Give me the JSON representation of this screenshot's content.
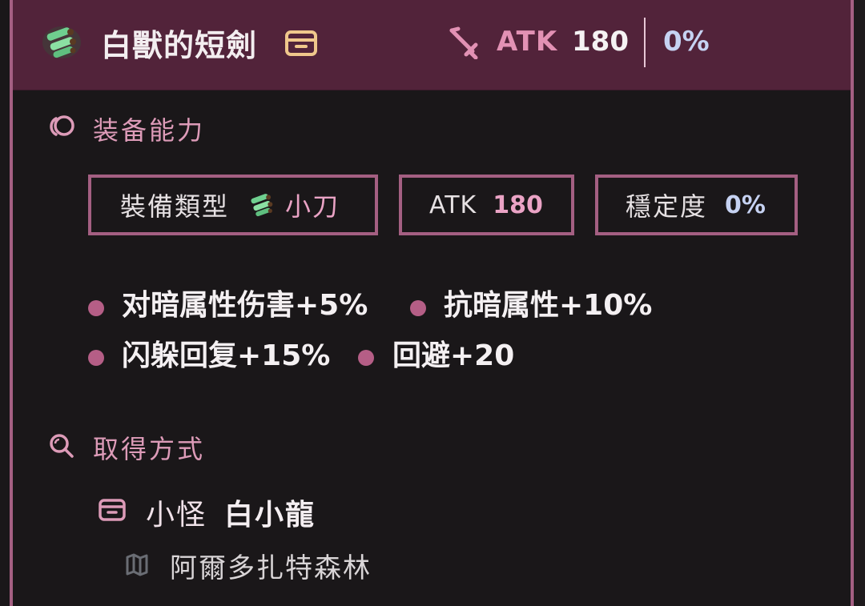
{
  "header": {
    "title": "白獸的短劍",
    "atk_label": "ATK",
    "atk_value": "180",
    "stability_value": "0%"
  },
  "abilities": {
    "section_title": "装备能力",
    "type_label": "裝備類型",
    "type_value": "小刀",
    "atk_label": "ATK",
    "atk_value": "180",
    "stability_label": "穩定度",
    "stability_value": "0%",
    "effects": [
      "对暗属性伤害+5%",
      "抗暗属性+10%",
      "闪躲回复+15%",
      "回避+20"
    ]
  },
  "acquisition": {
    "section_title": "取得方式",
    "source_type": "小怪",
    "source_name": "白小龍",
    "location": "阿爾多扎特森林"
  },
  "colors": {
    "header_bg": "#52233a",
    "border_accent": "#a45f82",
    "pink_accent": "#e291b4",
    "blue_accent": "#c6d2f2",
    "page_bg": "#1a1719"
  }
}
